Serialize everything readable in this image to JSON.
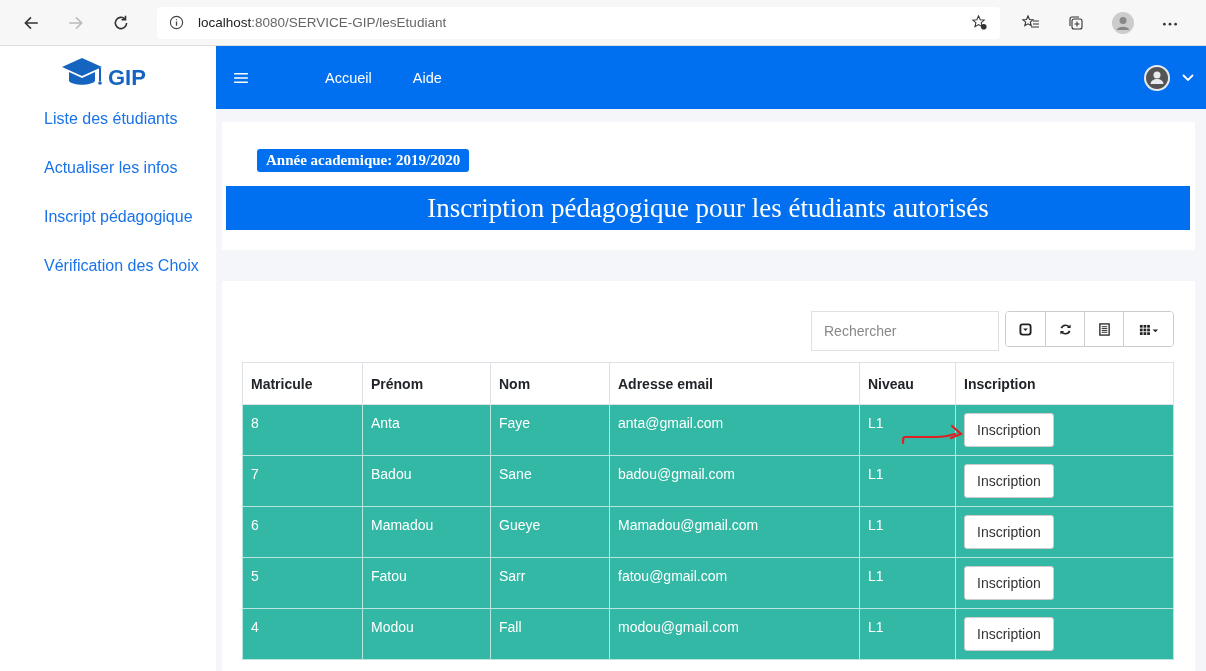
{
  "browser": {
    "url_host": "localhost",
    "url_path": ":8080/SERVICE-GIP/lesEtudiant",
    "forward_disabled": true
  },
  "brand": {
    "name": "GIP"
  },
  "sidebar": {
    "items": [
      {
        "label": "Liste des étudiants"
      },
      {
        "label": "Actualiser les infos"
      },
      {
        "label": "Inscript pédagogique"
      },
      {
        "label": "Vérification des Choix"
      }
    ]
  },
  "navbar": {
    "links": [
      "Accueil",
      "Aide"
    ]
  },
  "header": {
    "badge": "Année academique: 2019/2020",
    "title": "Inscription pédagogique pour les étudiants autorisés"
  },
  "search": {
    "placeholder": "Rechercher"
  },
  "table": {
    "columns": [
      "Matricule",
      "Prénom",
      "Nom",
      "Adresse email",
      "Niveau",
      "Inscription"
    ],
    "rows": [
      {
        "cells": [
          "8",
          "Anta",
          "Faye",
          "anta@gmail.com",
          "L1"
        ],
        "action": "Inscription",
        "marked": true
      },
      {
        "cells": [
          "7",
          "Badou",
          "Sane",
          "badou@gmail.com",
          "L1"
        ],
        "action": "Inscription",
        "marked": false
      },
      {
        "cells": [
          "6",
          "Mamadou",
          "Gueye",
          "Mamadou@gmail.com",
          "L1"
        ],
        "action": "Inscription",
        "marked": false
      },
      {
        "cells": [
          "5",
          "Fatou",
          "Sarr",
          "fatou@gmail.com",
          "L1"
        ],
        "action": "Inscription",
        "marked": false
      },
      {
        "cells": [
          "4",
          "Modou",
          "Fall",
          "modou@gmail.com",
          "L1"
        ],
        "action": "Inscription",
        "marked": false
      }
    ]
  }
}
